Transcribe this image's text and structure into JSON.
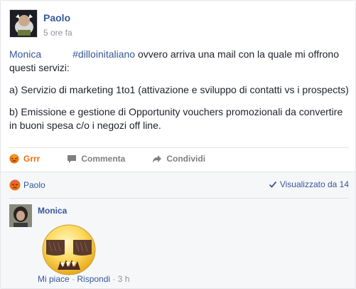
{
  "post": {
    "author": "Paolo",
    "time": "5 ore fa",
    "mention": "Monica",
    "hashtag": "#dilloinitaliano",
    "line1_rest": " ovvero arriva una mail con la quale mi offrono questi servizi:",
    "para_a": "a) Servizio di marketing 1to1 (attivazione e sviluppo di contatti vs i prospects)",
    "para_b": "b) Emissione e gestione di Opportunity vouchers promozionali da convertire in buoni spesa c/o i negozi off line."
  },
  "actions": {
    "reaction": "Grrr",
    "comment": "Commenta",
    "share": "Condividi"
  },
  "feedback": {
    "reactor": "Paolo",
    "seen_by": "Visualizzato da 14"
  },
  "comment": {
    "author": "Monica",
    "like": "Mi piace",
    "separator": " · ",
    "reply": "Rispondi",
    "time": "3 h"
  },
  "colors": {
    "link": "#365899",
    "grrr": "#e9710f",
    "muted": "#90949c"
  }
}
